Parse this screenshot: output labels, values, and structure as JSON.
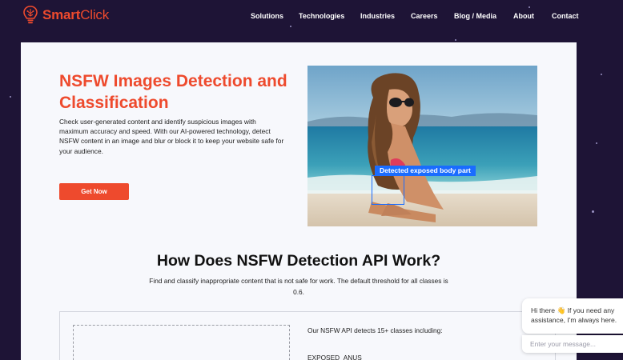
{
  "nav": {
    "brand_bold": "Smart",
    "brand_light": "Click",
    "links": [
      {
        "label": "Solutions"
      },
      {
        "label": "Technologies"
      },
      {
        "label": "Industries"
      },
      {
        "label": "Careers"
      },
      {
        "label": "Blog / Media"
      },
      {
        "label": "About"
      },
      {
        "label": "Contact"
      }
    ]
  },
  "hero": {
    "title": "NSFW Images Detection and Classification",
    "description": "Check user-generated content and identify suspicious images with maximum accuracy and speed. With our AI-powered technology, detect NSFW content in an image and blur or block it to keep your website safe for your audience.",
    "cta_label": "Get Now",
    "detection_label": "Detected exposed body part"
  },
  "section": {
    "title": "How Does NSFW Detection API Work?",
    "description": "Find and classify inappropriate content that is not safe for work. The default threshold for all classes is 0.6."
  },
  "demo": {
    "intro": "Our NSFW API detects 15+ classes including:",
    "first_class": "EXPOSED_ANUS"
  },
  "chat": {
    "greeting_line1": "Hi there 👋 If you need any",
    "greeting_line2": "assistance, I'm always here.",
    "placeholder": "Enter your message..."
  },
  "colors": {
    "background": "#1e1436",
    "accent": "#ee4a2d",
    "detection": "#1a6cff",
    "card": "#f7f8fc"
  }
}
